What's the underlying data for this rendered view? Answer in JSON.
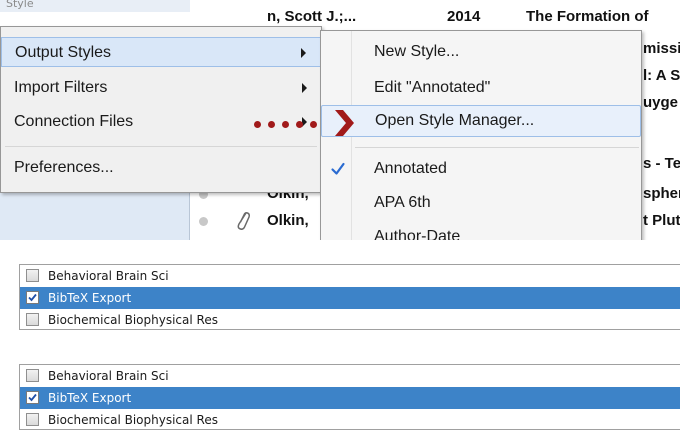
{
  "references": [
    {
      "author": "n, Scott J.;...",
      "year": "2014",
      "title": "The Formation of"
    },
    {
      "author": "",
      "year": "",
      "title": "missi"
    },
    {
      "author": "",
      "year": "",
      "title": "l: A S"
    },
    {
      "author": "",
      "year": "",
      "title": "uyge"
    },
    {
      "author": "",
      "year": "",
      "title": "s - Te"
    },
    {
      "author": "Olkin,",
      "year": "",
      "title": "spher"
    },
    {
      "author": "Olkin,",
      "year": "",
      "title": "t Plut"
    }
  ],
  "sidebar_top_text": "Style",
  "main_menu": {
    "items": [
      {
        "label": "Output Styles",
        "submenu": true
      },
      {
        "label": "Import Filters",
        "submenu": true
      },
      {
        "label": "Connection Files",
        "submenu": true
      },
      {
        "label": "Preferences...",
        "submenu": false
      }
    ]
  },
  "output_styles_menu": {
    "items": [
      {
        "label": "New Style...",
        "checked": false
      },
      {
        "label": "Edit \"Annotated\"",
        "checked": false
      },
      {
        "label": "Open Style Manager...",
        "checked": false
      },
      {
        "label": "Annotated",
        "checked": true
      },
      {
        "label": "APA 6th",
        "checked": false
      },
      {
        "label": "Author-Date",
        "checked": false
      }
    ]
  },
  "style_list_1": [
    {
      "label": "Behavioral Brain Sci",
      "checked": false,
      "selected": false
    },
    {
      "label": "BibTeX Export",
      "checked": true,
      "selected": true
    },
    {
      "label": "Biochemical Biophysical Res",
      "checked": false,
      "selected": false
    }
  ],
  "style_list_2": [
    {
      "label": "Behavioral Brain Sci",
      "checked": false,
      "selected": false
    },
    {
      "label": "BibTeX Export",
      "checked": true,
      "selected": true
    },
    {
      "label": "Biochemical Biophysical Res",
      "checked": false,
      "selected": false
    }
  ],
  "colors": {
    "selection_blue": "#3d83c8",
    "annotation_red": "#a11a1a",
    "check_blue": "#2a6bd1"
  }
}
